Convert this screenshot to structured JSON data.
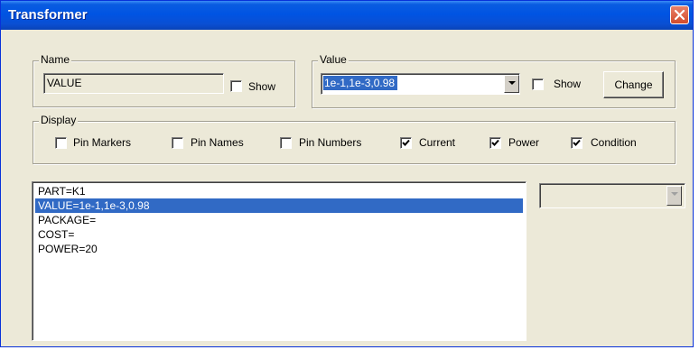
{
  "window": {
    "title": "Transformer"
  },
  "name_group": {
    "legend": "Name",
    "value": "VALUE",
    "show_label": "Show",
    "show_checked": false
  },
  "value_group": {
    "legend": "Value",
    "selected_value": "1e-1,1e-3,0.98",
    "show_label": "Show",
    "show_checked": false,
    "change_label": "Change"
  },
  "display_group": {
    "legend": "Display",
    "options": [
      {
        "label": "Pin Markers",
        "checked": false
      },
      {
        "label": "Pin Names",
        "checked": false
      },
      {
        "label": "Pin Numbers",
        "checked": false
      },
      {
        "label": "Current",
        "checked": true
      },
      {
        "label": "Power",
        "checked": true
      },
      {
        "label": "Condition",
        "checked": true
      }
    ]
  },
  "properties": {
    "items": [
      {
        "text": "PART=K1",
        "selected": false
      },
      {
        "text": "VALUE=1e-1,1e-3,0.98",
        "selected": true
      },
      {
        "text": "PACKAGE=",
        "selected": false
      },
      {
        "text": "COST=",
        "selected": false
      },
      {
        "text": "POWER=20",
        "selected": false
      }
    ]
  },
  "right_combo": {
    "value": "",
    "enabled": false
  },
  "colors": {
    "title_bar": "#0054e3",
    "selection": "#316ac5",
    "dialog_bg": "#ece9d8",
    "close_button": "#d24c2c"
  }
}
